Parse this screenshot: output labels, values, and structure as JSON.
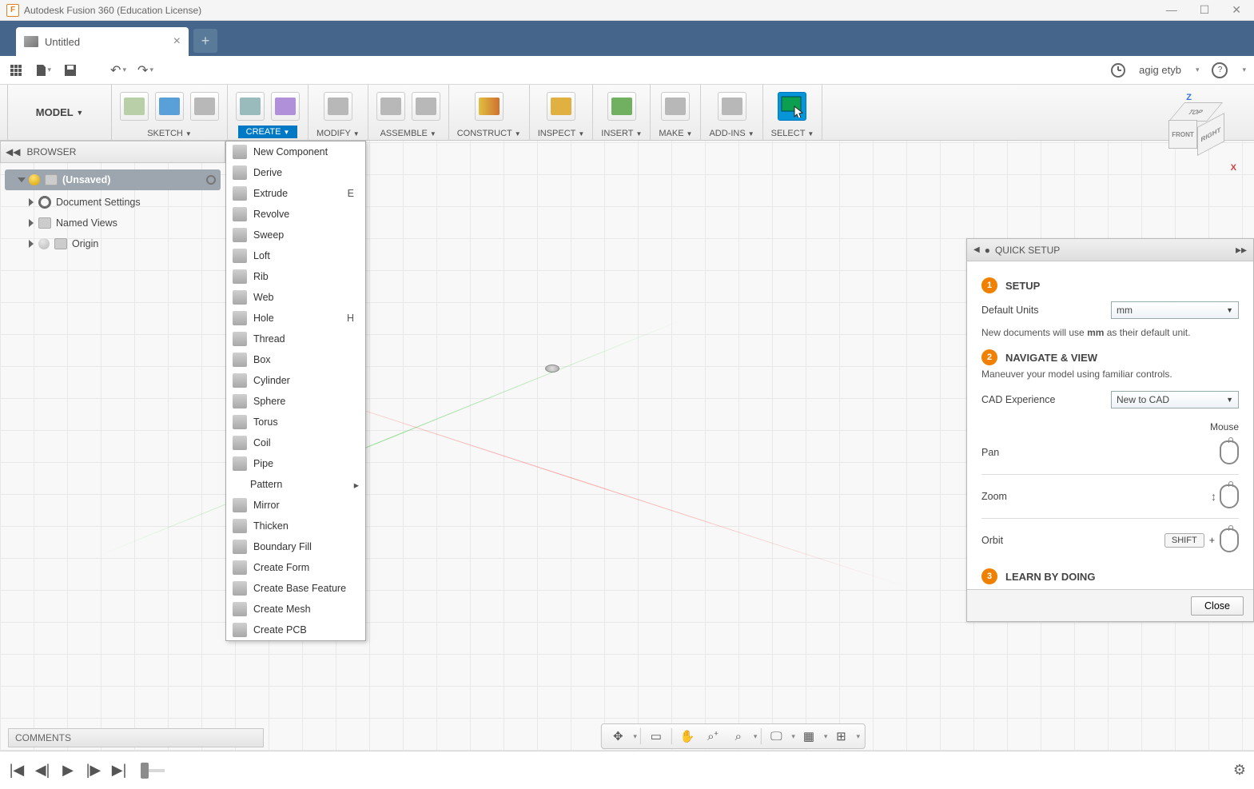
{
  "app": {
    "title": "Autodesk Fusion 360 (Education License)"
  },
  "tab": {
    "name": "Untitled"
  },
  "qat": {
    "user": "agig etyb"
  },
  "workspace_label": "MODEL",
  "ribbon": [
    {
      "label": "SKETCH"
    },
    {
      "label": "CREATE",
      "active": true
    },
    {
      "label": "MODIFY"
    },
    {
      "label": "ASSEMBLE"
    },
    {
      "label": "CONSTRUCT"
    },
    {
      "label": "INSPECT"
    },
    {
      "label": "INSERT"
    },
    {
      "label": "MAKE"
    },
    {
      "label": "ADD-INS"
    },
    {
      "label": "SELECT"
    }
  ],
  "browser": {
    "title": "BROWSER",
    "root": "(Unsaved)",
    "items": [
      "Document Settings",
      "Named Views",
      "Origin"
    ]
  },
  "create_menu": [
    {
      "label": "New Component"
    },
    {
      "label": "Derive"
    },
    {
      "label": "Extrude",
      "shortcut": "E"
    },
    {
      "label": "Revolve"
    },
    {
      "label": "Sweep"
    },
    {
      "label": "Loft"
    },
    {
      "label": "Rib"
    },
    {
      "label": "Web"
    },
    {
      "label": "Hole",
      "shortcut": "H"
    },
    {
      "label": "Thread"
    },
    {
      "label": "Box"
    },
    {
      "label": "Cylinder"
    },
    {
      "label": "Sphere"
    },
    {
      "label": "Torus"
    },
    {
      "label": "Coil"
    },
    {
      "label": "Pipe"
    },
    {
      "label": "Pattern",
      "haschild": true
    },
    {
      "label": "Mirror"
    },
    {
      "label": "Thicken"
    },
    {
      "label": "Boundary Fill"
    },
    {
      "label": "Create Form"
    },
    {
      "label": "Create Base Feature"
    },
    {
      "label": "Create Mesh"
    },
    {
      "label": "Create PCB"
    }
  ],
  "viewcube": {
    "top": "TOP",
    "front": "FRONT",
    "right": "RIGHT",
    "z": "Z",
    "x": "X"
  },
  "quicksetup": {
    "title": "QUICK SETUP",
    "step1": "SETUP",
    "units_label": "Default Units",
    "units_value": "mm",
    "units_note_pre": "New documents will use ",
    "units_note_bold": "mm",
    "units_note_post": " as their default unit.",
    "step2": "NAVIGATE & VIEW",
    "nav_note": "Maneuver your model using familiar controls.",
    "cad_label": "CAD Experience",
    "cad_value": "New to CAD",
    "mouse": "Mouse",
    "pan": "Pan",
    "zoom": "Zoom",
    "orbit": "Orbit",
    "shift": "SHIFT",
    "plus": "+",
    "step3": "LEARN BY DOING",
    "close": "Close"
  },
  "comments": "COMMENTS"
}
